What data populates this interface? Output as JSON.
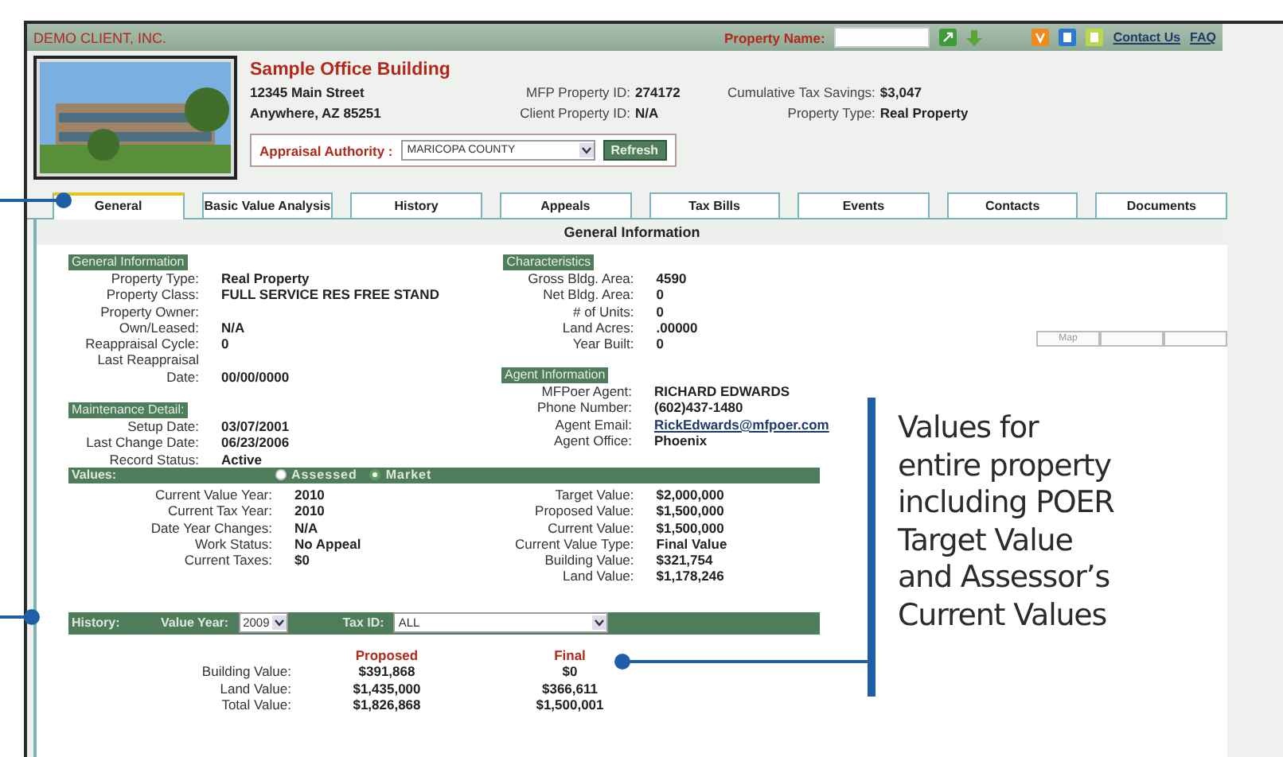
{
  "header": {
    "client": "DEMO CLIENT, INC.",
    "property_name_label": "Property Name:",
    "links": [
      "Contact Us",
      "FAQ"
    ]
  },
  "property": {
    "name": "Sample Office Building",
    "address": [
      "12345 Main Street",
      "Anywhere, AZ 85251"
    ],
    "ids": [
      {
        "label": "MFP Property ID:",
        "value": "274172"
      },
      {
        "label": "Client Property ID:",
        "value": "N/A"
      }
    ],
    "summary": [
      {
        "label": "Cumulative Tax Savings:",
        "value": "$3,047"
      },
      {
        "label": "Property Type:",
        "value": "Real Property"
      }
    ],
    "appraisal": {
      "label": "Appraisal Authority :",
      "value": "MARICOPA COUNTY",
      "button": "Refresh"
    }
  },
  "tabs": [
    {
      "label": "General",
      "selected": true
    },
    {
      "label": "Basic Value Analysis",
      "selected": false
    },
    {
      "label": "History",
      "selected": false
    },
    {
      "label": "Appeals",
      "selected": false
    },
    {
      "label": "Tax Bills",
      "selected": false
    },
    {
      "label": "Events",
      "selected": false
    },
    {
      "label": "Contacts",
      "selected": false
    },
    {
      "label": "Documents",
      "selected": false
    }
  ],
  "panel_title": "General Information",
  "sections": [
    {
      "title": "General Information",
      "rows": [
        {
          "label": "Property Type:",
          "value": "Real Property"
        },
        {
          "label": "Property Class:",
          "value": "FULL SERVICE RES FREE STAND"
        },
        {
          "label": "Property Owner:",
          "value": ""
        },
        {
          "label": "Own/Leased:",
          "value": "N/A"
        },
        {
          "label": "Reappraisal Cycle:",
          "value": "0"
        },
        {
          "label": "Last Reappraisal",
          "value": ""
        },
        {
          "label": "Date:",
          "value": "00/00/0000"
        }
      ]
    },
    {
      "title": "Characteristics",
      "rows": [
        {
          "label": "Gross Bldg. Area:",
          "value": "4590"
        },
        {
          "label": "Net Bldg. Area:",
          "value": "0"
        },
        {
          "label": "# of Units:",
          "value": "0"
        },
        {
          "label": "Land Acres:",
          "value": ".00000"
        },
        {
          "label": "Year Built:",
          "value": "0"
        }
      ]
    },
    {
      "title": "Agent Information",
      "rows": [
        {
          "label": "MFPoer Agent:",
          "value": "RICHARD EDWARDS"
        },
        {
          "label": "Phone Number:",
          "value": "(602)437-1480"
        },
        {
          "label": "Agent Email:",
          "value": "RickEdwards@mfpoer.com",
          "kind": "link"
        },
        {
          "label": "Agent Office:",
          "value": "Phoenix"
        }
      ]
    },
    {
      "title": "Maintenance Detail:",
      "rows": [
        {
          "label": "Setup Date:",
          "value": "03/07/2001"
        },
        {
          "label": "Last Change Date:",
          "value": "06/23/2006"
        },
        {
          "label": "Record Status:",
          "value": "Active"
        }
      ]
    }
  ],
  "values": {
    "label": "Values:",
    "options": [
      {
        "label": "Assessed",
        "selected": false
      },
      {
        "label": "Market",
        "selected": true
      }
    ],
    "left": [
      {
        "label": "Current Value Year:",
        "value": "2010"
      },
      {
        "label": "Current Tax Year:",
        "value": "2010"
      },
      {
        "label": "Date Year Changes:",
        "value": "N/A"
      },
      {
        "label": "Work Status:",
        "value": "No Appeal"
      },
      {
        "label": "Current Taxes:",
        "value": "$0"
      }
    ],
    "right": [
      {
        "label": "Target Value:",
        "value": "$2,000,000"
      },
      {
        "label": "Proposed Value:",
        "value": "$1,500,000"
      },
      {
        "label": "Current Value:",
        "value": "$1,500,000"
      },
      {
        "label": "Current Value Type:",
        "value": "Final Value"
      },
      {
        "label": "Building Value:",
        "value": "$321,754"
      },
      {
        "label": "Land Value:",
        "value": "$1,178,246"
      }
    ]
  },
  "history": {
    "label": "History:",
    "year_label": "Value Year:",
    "year": "2009",
    "tax_label": "Tax ID:",
    "tax": "ALL",
    "columns": [
      "Proposed",
      "Final"
    ],
    "rows": [
      {
        "label": "Building Value:",
        "proposed": "$391,868",
        "final": "$0"
      },
      {
        "label": "Land Value:",
        "proposed": "$1,435,000",
        "final": "$366,611"
      },
      {
        "label": "Total Value:",
        "proposed": "$1,826,868",
        "final": "$1,500,001"
      }
    ]
  },
  "map_buttons": [
    "Map"
  ],
  "callout": {
    "lines": [
      "Values for",
      "entire property",
      "including POER",
      "Target Value",
      "and Assessor’s",
      "Current Values"
    ]
  }
}
